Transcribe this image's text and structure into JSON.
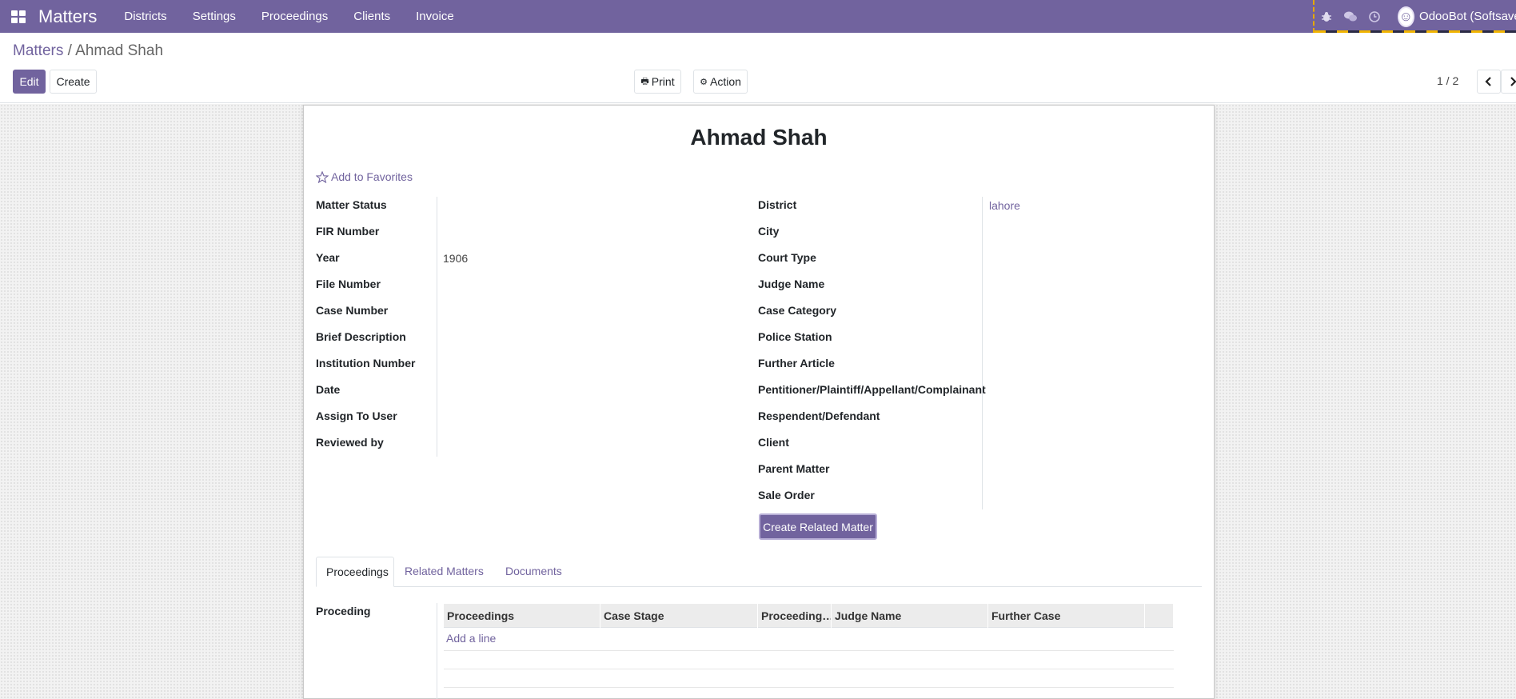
{
  "navbar": {
    "brand": "Matters",
    "menu": [
      "Districts",
      "Settings",
      "Proceedings",
      "Clients",
      "Invoice"
    ],
    "user": "OdooBot (Softsave"
  },
  "breadcrumb": {
    "parent": "Matters",
    "separator": " / ",
    "current": "Ahmad Shah"
  },
  "buttons": {
    "edit": "Edit",
    "create": "Create",
    "print": "Print",
    "action": "Action",
    "pager": "1 / 2"
  },
  "record": {
    "title": "Ahmad Shah",
    "favorite": "Add to Favorites",
    "left_fields": [
      {
        "label": "Matter Status",
        "value": ""
      },
      {
        "label": "FIR Number",
        "value": ""
      },
      {
        "label": "Year",
        "value": "1906"
      },
      {
        "label": "File Number",
        "value": ""
      },
      {
        "label": "Case Number",
        "value": ""
      },
      {
        "label": "Brief Description",
        "value": ""
      },
      {
        "label": "Institution Number",
        "value": ""
      },
      {
        "label": "Date",
        "value": ""
      },
      {
        "label": "Assign To User",
        "value": ""
      },
      {
        "label": "Reviewed by",
        "value": ""
      }
    ],
    "right_fields": [
      {
        "label": "District",
        "value": "lahore"
      },
      {
        "label": "City",
        "value": ""
      },
      {
        "label": "Court Type",
        "value": ""
      },
      {
        "label": "Judge Name",
        "value": ""
      },
      {
        "label": "Case Category",
        "value": ""
      },
      {
        "label": "Police Station",
        "value": ""
      },
      {
        "label": "Further Article",
        "value": ""
      },
      {
        "label": "Pentitioner/Plaintiff/Appellant/Complainant",
        "value": ""
      },
      {
        "label": "Respendent/Defendant",
        "value": ""
      },
      {
        "label": "Client",
        "value": ""
      },
      {
        "label": "Parent Matter",
        "value": ""
      },
      {
        "label": "Sale Order",
        "value": ""
      }
    ],
    "related_button": "Create Related Matter"
  },
  "tabs": [
    "Proceedings",
    "Related Matters",
    "Documents"
  ],
  "proceedings": {
    "label": "Proceding",
    "columns": [
      "Proceedings",
      "Case Stage",
      "Proceeding…",
      "Judge Name",
      "Further Case"
    ],
    "add_line": "Add a line"
  }
}
